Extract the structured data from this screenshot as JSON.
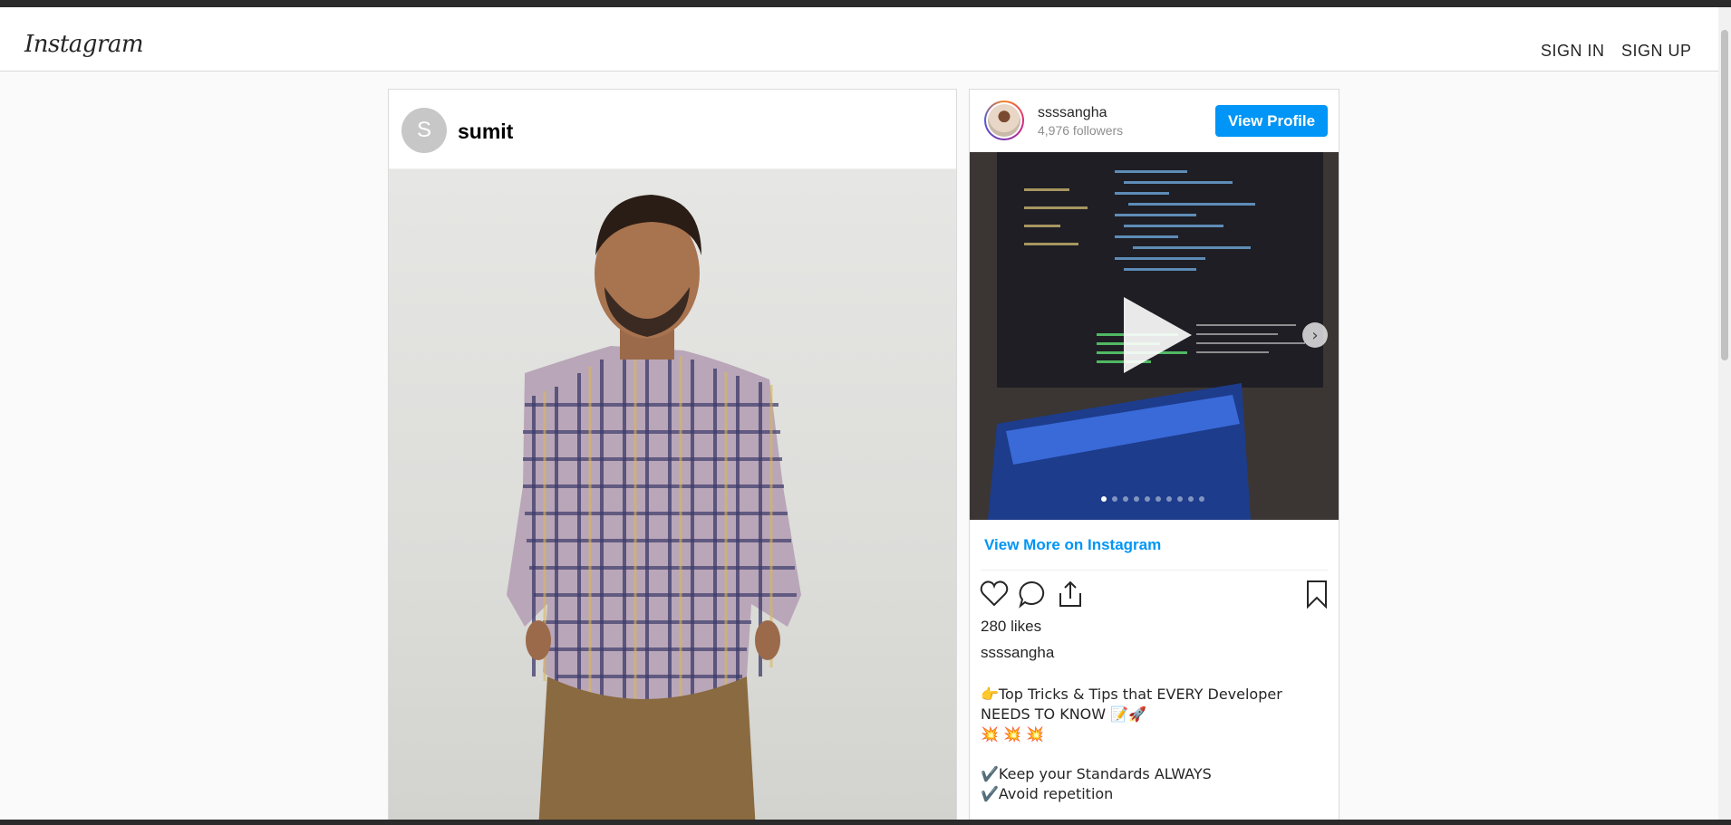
{
  "header": {
    "logo": "Instagram",
    "sign_in": "SIGN IN",
    "sign_up": "SIGN UP"
  },
  "post": {
    "avatar_letter": "S",
    "username": "sumit"
  },
  "embed": {
    "username": "ssssangha",
    "followers": "4,976 followers",
    "view_profile": "View Profile",
    "view_more": "View More on Instagram",
    "likes": "280 likes",
    "caption_user": "ssssangha",
    "caption_lines": [
      "👉Top Tricks & Tips that EVERY Developer",
      "NEEDS TO KNOW 📝🚀",
      "💥 💥 💥",
      "",
      "✔️Keep your Standards ALWAYS",
      "✔️Avoid repetition"
    ],
    "carousel_dots": 10,
    "carousel_active": 1
  },
  "colors": {
    "accent": "#0095f6",
    "text": "#262626",
    "muted": "#8e8e8e",
    "border": "#dbdbdb"
  },
  "icons": [
    "heart-icon",
    "comment-icon",
    "share-icon",
    "bookmark-icon",
    "play-icon",
    "chevron-right-icon"
  ]
}
